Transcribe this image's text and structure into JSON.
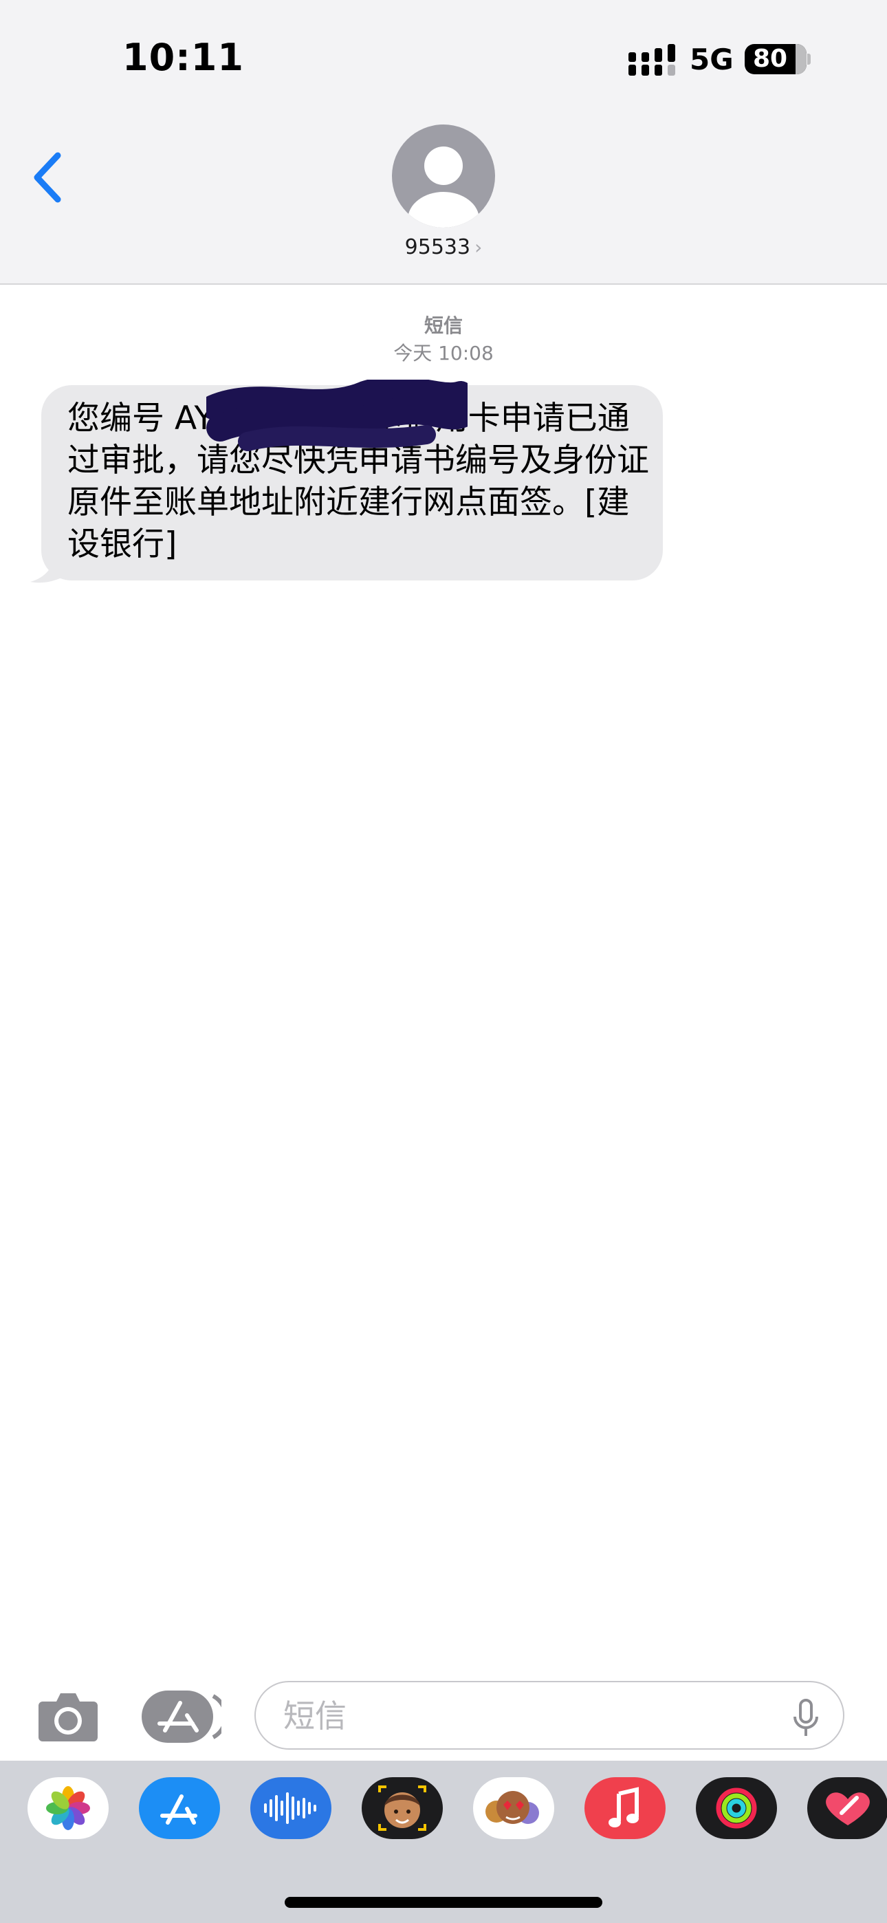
{
  "status_bar": {
    "time": "10:11",
    "network": "5G",
    "battery": "80"
  },
  "header": {
    "contact_name": "95533",
    "chevron": "›"
  },
  "conversation": {
    "service_label": "短信",
    "timestamp": "今天 10:08",
    "message_text": "您编号 AY23 76的龙卡信用卡申请已通过审批，请您尽快凭申请书编号及身份证原件至账单地址附近建行网点面签。[建设银行]"
  },
  "input_bar": {
    "placeholder": "短信"
  },
  "app_drawer": {
    "apps": [
      "photos-icon",
      "app-store-icon",
      "audio-messages-icon",
      "memoji-icon",
      "animoji-stickers-icon",
      "music-icon",
      "fitness-icon",
      "digital-touch-icon"
    ]
  },
  "colors": {
    "accent_blue": "#1a7cf6",
    "bubble_gray": "#e9e9eb",
    "header_bg": "#f3f3f5",
    "drawer_bg": "#d1d3d9"
  }
}
